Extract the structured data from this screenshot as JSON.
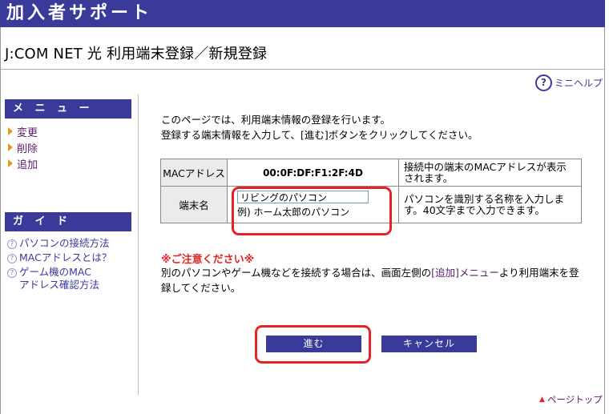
{
  "header": {
    "banner": "加入者サポート"
  },
  "page": {
    "title": "J:COM NET 光  利用端末登録／新規登録",
    "help_label": "ミニヘルプ"
  },
  "sidebar": {
    "menu_title": "メ ニ ュ ー",
    "menu_items": [
      {
        "label": "変更"
      },
      {
        "label": "削除"
      },
      {
        "label": "追加"
      }
    ],
    "guide_title": "ガ イ ド",
    "guide_items": [
      {
        "line1": "パソコンの接続方法",
        "line2": ""
      },
      {
        "line1": "MACアドレスとは？",
        "line2": ""
      },
      {
        "line1": "ゲーム機のMAC",
        "line2": "アドレス確認方法"
      }
    ]
  },
  "main": {
    "intro_line1": "このページでは、利用端末情報の登録を行います。",
    "intro_line2": "登録する端末情報を入力して、[進む]ボタンをクリックしてください。",
    "mac_row": {
      "label": "MACアドレス",
      "value": "00:0F:DF:F1:2F:4D",
      "description": "接続中の端末のMACアドレスが表示されます。"
    },
    "name_row": {
      "label": "端末名",
      "input_value": "リビングのパソコン",
      "example": "例) ホーム太郎のパソコン",
      "description": "パソコンを識別する名称を入力します。40文字まで入力できます。"
    },
    "caution_title": "※ご注意ください※",
    "caution_before": "別のパソコンやゲーム機などを接続する場合は、画面左側の",
    "caution_link": "[追加]メニュー",
    "caution_after": "より利用端末を登録してください。",
    "submit_label": "進む",
    "cancel_label": "キャンセル",
    "page_top": "ページトップ"
  },
  "colors": {
    "brand": "#3a3a9a",
    "highlight": "#e32424",
    "menu_link": "#5a1a6a",
    "arrow": "#e39a1e"
  }
}
